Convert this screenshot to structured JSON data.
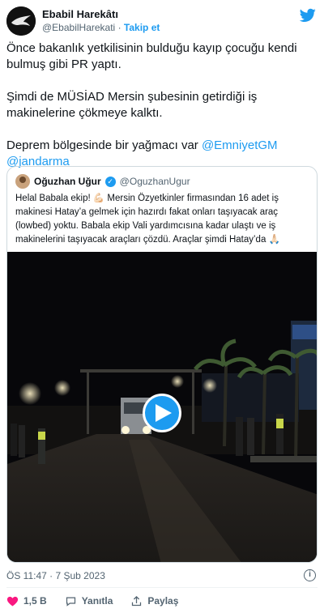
{
  "author": {
    "display_name": "Ebabil Harekâtı",
    "handle": "@EbabilHarekati",
    "separator": "·",
    "follow_label": "Takip et"
  },
  "logo_icon": "twitter-bird-icon",
  "tweet": {
    "paragraphs": [
      "Önce bakanlık yetkilisinin bulduğu kayıp çocuğu kendi bulmuş gibi PR yaptı.",
      "Şimdi de MÜSİAD Mersin şubesinin getirdiği iş makinelerine çökmeye kalktı."
    ],
    "last_paragraph_text": "Deprem bölgesinde bir yağmacı var ",
    "mentions": [
      "@EmniyetGM",
      "@jandarma"
    ]
  },
  "quoted_tweet": {
    "display_name": "Oğuzhan Uğur",
    "verified_icon": "verified-badge-icon",
    "handle": "@OguzhanUgur",
    "text": "Helal Babala ekip! 💪🏻 Mersin Özyetkinler firmasından 16 adet iş makinesi Hatay’a gelmek için hazırdı fakat onları taşıyacak araç (lowbed) yoktu. Babala ekip Vali yardımcısına kadar ulaştı ve iş makinelerini taşıyacak araçları çözdü. Araçlar şimdi Hatay’da 🙏🏻",
    "video": {
      "play_icon": "play-icon"
    }
  },
  "meta": {
    "timestamp": "ÖS 11:47 · 7 Şub 2023",
    "info_icon_text": "i"
  },
  "actions": {
    "like_count": "1,5 B",
    "reply_label": "Yanıtla",
    "share_label": "Paylaş"
  },
  "colors": {
    "accent": "#1d9bf0",
    "like": "#f91880",
    "text": "#0f1419",
    "secondary": "#536471"
  }
}
